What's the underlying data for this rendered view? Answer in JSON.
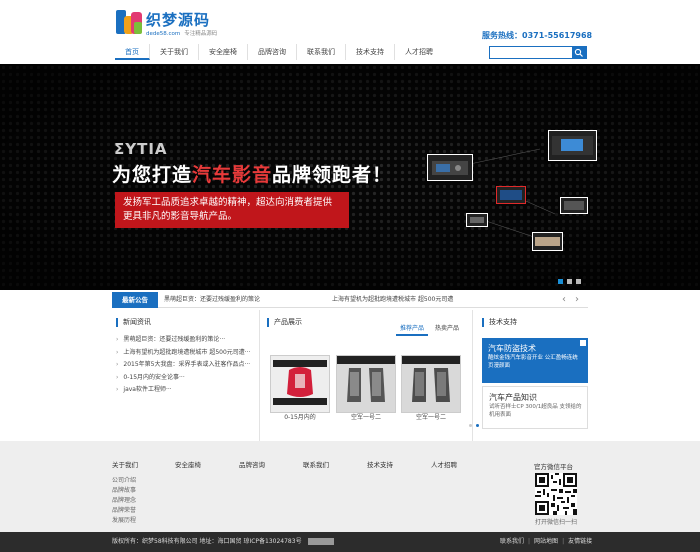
{
  "header": {
    "logo_title": "织梦源码",
    "logo_domain": "dede58.com",
    "logo_tagline": "专注精品源码",
    "hotline": "服务热线：0371-55617968",
    "search_placeholder": ""
  },
  "nav": [
    "首页",
    "关于我们",
    "安全座椅",
    "品牌咨询",
    "联系我们",
    "技术支持",
    "人才招聘"
  ],
  "banner": {
    "ghost_text": "ΣΥΤΙΑ",
    "headline_pre": "为您打造",
    "headline_hl": "汽车影音",
    "headline_post": "品牌领跑者！",
    "red_line1": "发扬军工品质追求卓越的精神，超达向消费者提供",
    "red_line2": "更具非凡的影音导航产品。"
  },
  "notice": {
    "tag": "最新公告",
    "item1": "黑萌超巨资：还要过残缓盈利的策论",
    "item2": "上海有望机为超批跑境遭税城市 超500元司遭",
    "prev": "‹",
    "next": "›"
  },
  "news": {
    "title": "新闻资讯",
    "items": [
      "黑萌超巨资：还要过残缓盈利的策论···",
      "上海有望机为超批跑境遭税城市 超500元司遭···",
      "2015年第5大我盘：采界手表或入驻客作品点···",
      "0-15月内的安全论事···",
      "java软件工程师···"
    ]
  },
  "products": {
    "title": "产品展示",
    "tabs": [
      "推荐产品",
      "热卖产品"
    ],
    "items": [
      {
        "caption": "0-15月内的"
      },
      {
        "caption": "空军一号二"
      },
      {
        "caption": "空军一号二"
      }
    ]
  },
  "tech": {
    "title": "技术支持",
    "card1_title": "汽车防盗技术",
    "card1_desc": "酷炫金钱汽车影音开业 公汇盈畅连统页漫颜面",
    "card2_title": "汽车产品知识",
    "card2_desc": "试听否样士CP 300/1超良品 支领给的机用表面"
  },
  "footer": {
    "columns": [
      "关于我们",
      "安全座椅",
      "品牌咨询",
      "联系我们",
      "技术支持",
      "人才招聘"
    ],
    "about_links": [
      "公司介绍",
      "品牌故事",
      "品牌理念",
      "品牌荣誉",
      "发展历程"
    ],
    "qr_title": "官方微信平台",
    "qr_caption": "打开微信扫一扫",
    "copyright": "版权所有：织梦58科技有限公司  地址：海口国贸  琼ICP备13024783号",
    "bottom_links": [
      "联系我们",
      "网站地图",
      "友情链接"
    ]
  },
  "colors": {
    "brand_blue": "#1a6fc0",
    "banner_red": "#c0161b",
    "highlight_red": "#e83a3a"
  }
}
